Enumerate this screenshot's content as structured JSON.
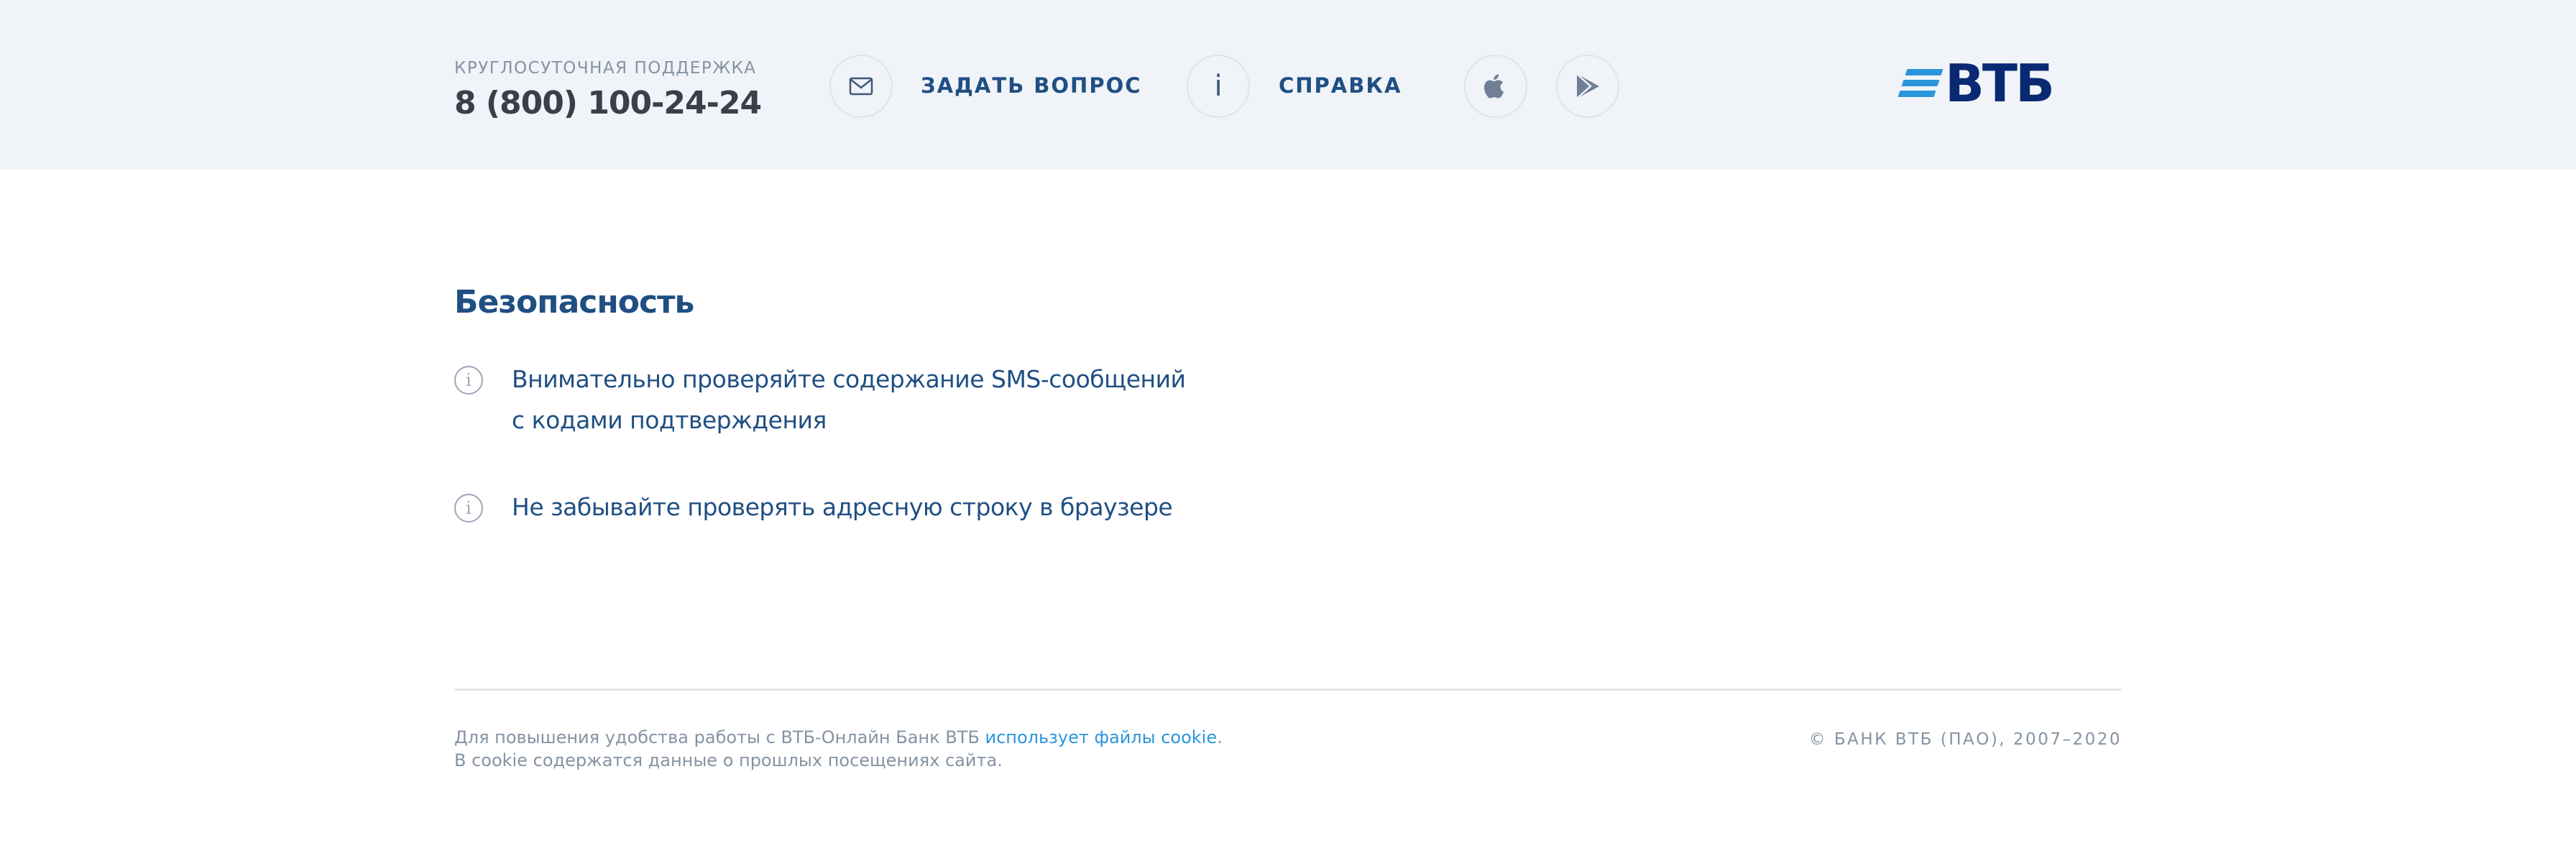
{
  "header": {
    "support_label": "КРУГЛОСУТОЧНАЯ ПОДДЕРЖКА",
    "support_phone": "8 (800) 100-24-24",
    "ask_question_label": "ЗАДАТЬ ВОПРОС",
    "help_label": "СПРАВКА",
    "info_glyph": "i",
    "logo_text": "ВТБ",
    "icons": [
      "mail-icon",
      "info-icon",
      "apple-icon",
      "google-play-icon"
    ]
  },
  "security": {
    "title": "Безопасность",
    "items": [
      {
        "line1": "Внимательно проверяйте содержание SMS-сообщений",
        "line2": "с кодами подтверждения"
      },
      {
        "line1": "Не забывайте проверять адресную строку в браузере"
      }
    ]
  },
  "footer": {
    "cookie_text_1": "Для повышения удобства работы с ВТБ-Онлайн Банк ВТБ ",
    "cookie_link": "использует файлы cookie",
    "cookie_text_2": ". В cookie содержатся данные о прошлых посещениях сайта.",
    "copyright": "© БАНК ВТБ (ПАО), 2007–2020"
  },
  "colors": {
    "topbar_bg": "#f0f3f8",
    "primary_text": "#1f4f83",
    "link": "#2b95dc",
    "logo": "#0a2973",
    "muted": "#8593a3"
  }
}
